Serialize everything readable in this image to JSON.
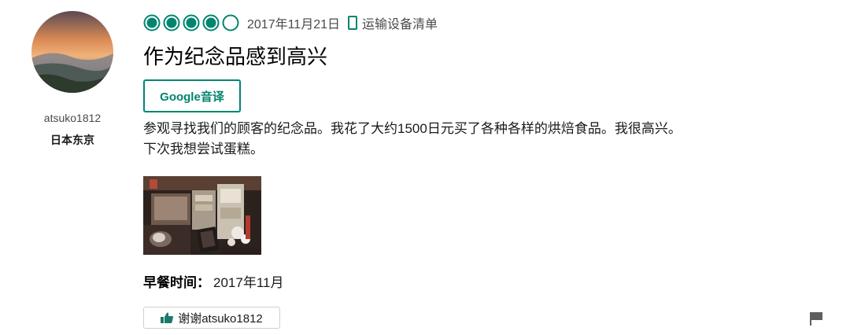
{
  "reviewer": {
    "username": "atsuko1812",
    "location": "日本东京"
  },
  "review": {
    "rating": 4,
    "rating_max": 5,
    "date": "2017年11月21日",
    "device_label": "运输设备清单",
    "title": "作为纪念品感到高兴",
    "translate_button": "Google音译",
    "body_lines": [
      "参观寻找我们的顾客的纪念品。我花了大约1500日元买了各种各样的烘焙食品。我很高兴。",
      "下次我想尝试蛋糕。"
    ],
    "visit_label": "早餐时间：",
    "visit_value": "2017年11月",
    "thanks_button": "谢谢atsuko1812"
  },
  "colors": {
    "accent": "#00856f",
    "text": "#1a1a1a",
    "muted": "#4a4a4a"
  },
  "icons": [
    "rating-bubble-icon",
    "mobile-device-icon",
    "thumbs-up-icon",
    "flag-icon"
  ]
}
